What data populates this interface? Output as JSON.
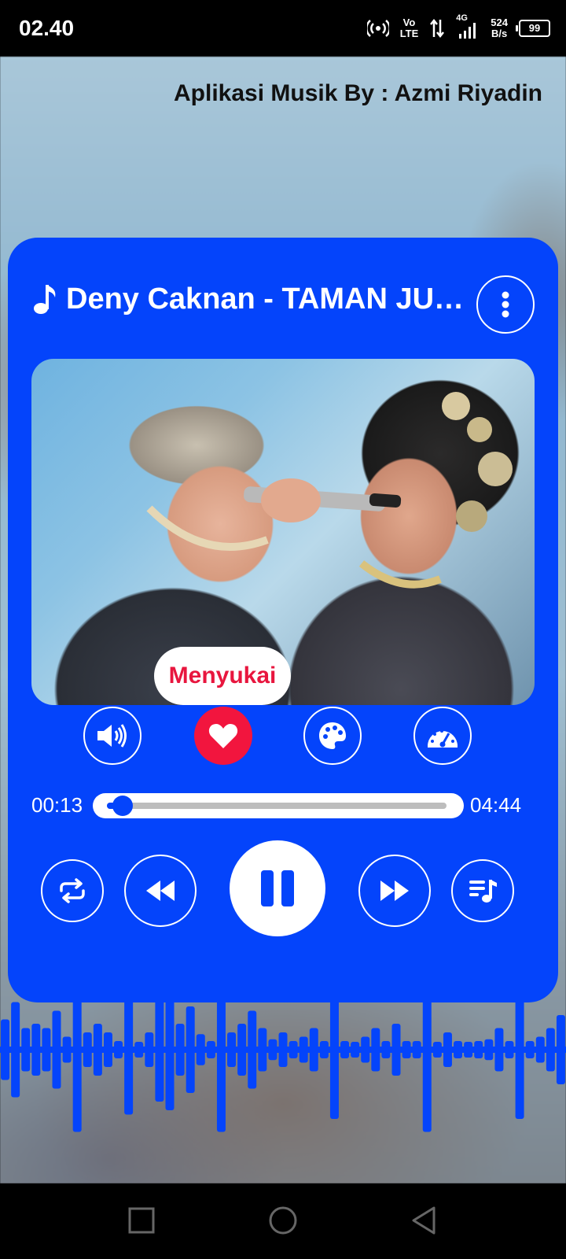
{
  "status_bar": {
    "time": "02.40",
    "network_vo": "Vo",
    "network_lte": "LTE",
    "network_4g": "4G",
    "speed_value": "524",
    "speed_unit": "B/s",
    "battery": "99"
  },
  "header": {
    "credit": "Aplikasi Musik By : Azmi Riyadin"
  },
  "player": {
    "song_title": "Deny Caknan - TAMAN JURIT",
    "like_tooltip": "Menyukai",
    "current_time": "00:13",
    "total_time": "04:44",
    "progress": 0.046
  },
  "visualizer": {
    "bar_levels": [
      0.35,
      0.55,
      0.25,
      0.3,
      0.25,
      0.45,
      0.15,
      0.95,
      0.2,
      0.3,
      0.2,
      0.1,
      0.75,
      0.08,
      0.2,
      0.6,
      0.7,
      0.3,
      0.5,
      0.18,
      0.1,
      0.95,
      0.2,
      0.3,
      0.45,
      0.25,
      0.12,
      0.2,
      0.1,
      0.15,
      0.25,
      0.1,
      0.8,
      0.1,
      0.05,
      0.15,
      0.25,
      0.1,
      0.3,
      0.1,
      0.1,
      0.95,
      0.08,
      0.2,
      0.1,
      0.08,
      0.1,
      0.12,
      0.25,
      0.1,
      0.8,
      0.1,
      0.15,
      0.25,
      0.4
    ],
    "bar_color": "#0444fb"
  },
  "colors": {
    "accent": "#0444fb",
    "like": "#f2153e"
  }
}
